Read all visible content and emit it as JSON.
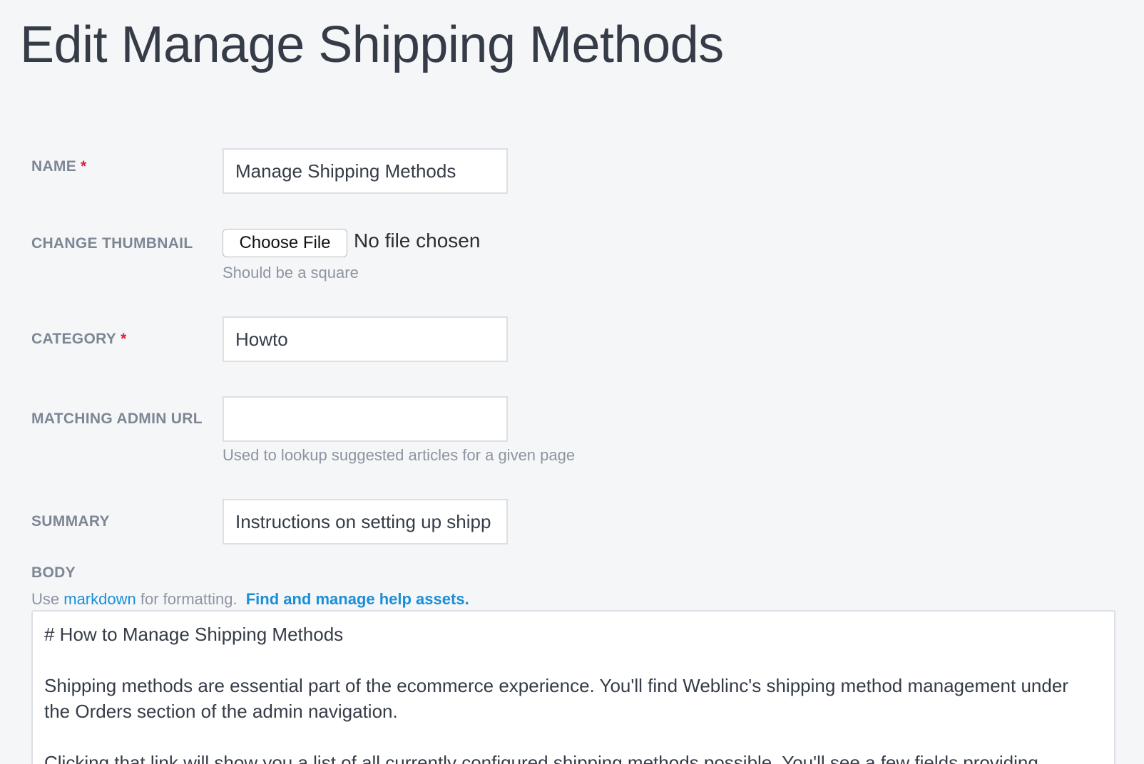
{
  "page": {
    "title": "Edit Manage Shipping Methods"
  },
  "form": {
    "required_mark": "*",
    "name": {
      "label": "NAME",
      "value": "Manage Shipping Methods"
    },
    "thumbnail": {
      "label": "CHANGE THUMBNAIL",
      "button_label": "Choose File",
      "status": "No file chosen",
      "hint": "Should be a square"
    },
    "category": {
      "label": "CATEGORY",
      "value": "Howto"
    },
    "admin_url": {
      "label": "MATCHING ADMIN URL",
      "value": "",
      "hint": "Used to lookup suggested articles for a given page"
    },
    "summary": {
      "label": "SUMMARY",
      "value": "Instructions on setting up shipp"
    },
    "body": {
      "label": "BODY",
      "help_prefix": "Use",
      "help_link": "markdown",
      "help_middle": "for formatting.",
      "help_assets_link": "Find and manage help assets.",
      "lines": {
        "heading": "# How to Manage Shipping Methods",
        "p1_line1": "Shipping methods are essential part of the ecommerce experience. You'll find Weblinc's shipping method management under",
        "p1_line2": "the Orders section of the admin navigation.",
        "p2_line1": "Clicking that link will show you a list of all currently configured shipping methods possible. You'll see a few fields providing"
      }
    }
  }
}
